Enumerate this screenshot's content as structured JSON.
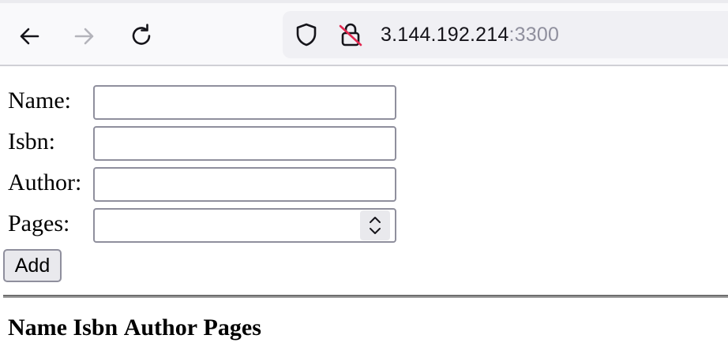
{
  "browser": {
    "url_host": "3.144.192.214",
    "url_port": ":3300",
    "icons": [
      "back-arrow-icon",
      "forward-arrow-icon",
      "reload-icon",
      "shield-icon",
      "insecure-lock-icon"
    ]
  },
  "form": {
    "name_label": "Name:",
    "isbn_label": "Isbn:",
    "author_label": "Author:",
    "pages_label": "Pages:",
    "name_value": "",
    "isbn_value": "",
    "author_value": "",
    "pages_value": "",
    "add_label": "Add"
  },
  "table": {
    "headers": [
      "Name",
      "Isbn",
      "Author",
      "Pages"
    ]
  }
}
